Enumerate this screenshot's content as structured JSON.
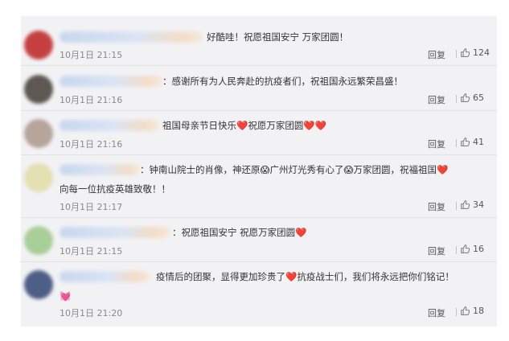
{
  "comments": [
    {
      "text": "好酷哇！祝愿祖国安宁 万家团圆！",
      "text2": "",
      "time": "10月1日 21:15",
      "reply": "回复",
      "likes": "124",
      "avatar_color": "#c44040"
    },
    {
      "text": "：感谢所有为人民奔赴的抗疫者们，祝祖国永远繁荣昌盛！",
      "text2": "",
      "time": "10月1日 21:16",
      "reply": "回复",
      "likes": "65",
      "avatar_color": "#5e5852"
    },
    {
      "text": "祖国母亲节日快乐❤️祝愿万家团圆❤️❤️",
      "text2": "",
      "time": "10月1日 21:16",
      "reply": "回复",
      "likes": "41",
      "avatar_color": "#b7a49a"
    },
    {
      "text": "：钟南山院士的肖像，神还原😱广州灯光秀有心了😱万家团圆，祝福祖国❤️",
      "text2": "向每一位抗疫英雄致敬！！",
      "time": "10月1日 21:17",
      "reply": "回复",
      "likes": "34",
      "avatar_color": "#e3e0b2"
    },
    {
      "text": "：祝愿祖国安宁 祝愿万家团圆❤️",
      "text2": "",
      "time": "10月1日 21:15",
      "reply": "回复",
      "likes": "16",
      "avatar_color": "#a8cf98"
    },
    {
      "text": "疫情后的团聚，显得更加珍贵了❤️抗疫战士们，我们将永远把你们铭记！",
      "text2": "💓",
      "time": "10月1日 21:20",
      "reply": "回复",
      "likes": "18",
      "avatar_color": "#4d5f86"
    }
  ]
}
